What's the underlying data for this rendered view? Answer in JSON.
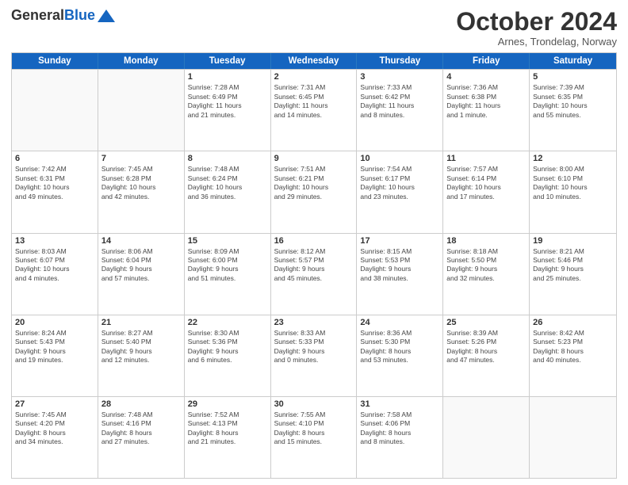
{
  "header": {
    "logo_general": "General",
    "logo_blue": "Blue",
    "month": "October 2024",
    "location": "Arnes, Trondelag, Norway"
  },
  "days_of_week": [
    "Sunday",
    "Monday",
    "Tuesday",
    "Wednesday",
    "Thursday",
    "Friday",
    "Saturday"
  ],
  "weeks": [
    [
      {
        "date": "",
        "info": ""
      },
      {
        "date": "",
        "info": ""
      },
      {
        "date": "1",
        "info": "Sunrise: 7:28 AM\nSunset: 6:49 PM\nDaylight: 11 hours\nand 21 minutes."
      },
      {
        "date": "2",
        "info": "Sunrise: 7:31 AM\nSunset: 6:45 PM\nDaylight: 11 hours\nand 14 minutes."
      },
      {
        "date": "3",
        "info": "Sunrise: 7:33 AM\nSunset: 6:42 PM\nDaylight: 11 hours\nand 8 minutes."
      },
      {
        "date": "4",
        "info": "Sunrise: 7:36 AM\nSunset: 6:38 PM\nDaylight: 11 hours\nand 1 minute."
      },
      {
        "date": "5",
        "info": "Sunrise: 7:39 AM\nSunset: 6:35 PM\nDaylight: 10 hours\nand 55 minutes."
      }
    ],
    [
      {
        "date": "6",
        "info": "Sunrise: 7:42 AM\nSunset: 6:31 PM\nDaylight: 10 hours\nand 49 minutes."
      },
      {
        "date": "7",
        "info": "Sunrise: 7:45 AM\nSunset: 6:28 PM\nDaylight: 10 hours\nand 42 minutes."
      },
      {
        "date": "8",
        "info": "Sunrise: 7:48 AM\nSunset: 6:24 PM\nDaylight: 10 hours\nand 36 minutes."
      },
      {
        "date": "9",
        "info": "Sunrise: 7:51 AM\nSunset: 6:21 PM\nDaylight: 10 hours\nand 29 minutes."
      },
      {
        "date": "10",
        "info": "Sunrise: 7:54 AM\nSunset: 6:17 PM\nDaylight: 10 hours\nand 23 minutes."
      },
      {
        "date": "11",
        "info": "Sunrise: 7:57 AM\nSunset: 6:14 PM\nDaylight: 10 hours\nand 17 minutes."
      },
      {
        "date": "12",
        "info": "Sunrise: 8:00 AM\nSunset: 6:10 PM\nDaylight: 10 hours\nand 10 minutes."
      }
    ],
    [
      {
        "date": "13",
        "info": "Sunrise: 8:03 AM\nSunset: 6:07 PM\nDaylight: 10 hours\nand 4 minutes."
      },
      {
        "date": "14",
        "info": "Sunrise: 8:06 AM\nSunset: 6:04 PM\nDaylight: 9 hours\nand 57 minutes."
      },
      {
        "date": "15",
        "info": "Sunrise: 8:09 AM\nSunset: 6:00 PM\nDaylight: 9 hours\nand 51 minutes."
      },
      {
        "date": "16",
        "info": "Sunrise: 8:12 AM\nSunset: 5:57 PM\nDaylight: 9 hours\nand 45 minutes."
      },
      {
        "date": "17",
        "info": "Sunrise: 8:15 AM\nSunset: 5:53 PM\nDaylight: 9 hours\nand 38 minutes."
      },
      {
        "date": "18",
        "info": "Sunrise: 8:18 AM\nSunset: 5:50 PM\nDaylight: 9 hours\nand 32 minutes."
      },
      {
        "date": "19",
        "info": "Sunrise: 8:21 AM\nSunset: 5:46 PM\nDaylight: 9 hours\nand 25 minutes."
      }
    ],
    [
      {
        "date": "20",
        "info": "Sunrise: 8:24 AM\nSunset: 5:43 PM\nDaylight: 9 hours\nand 19 minutes."
      },
      {
        "date": "21",
        "info": "Sunrise: 8:27 AM\nSunset: 5:40 PM\nDaylight: 9 hours\nand 12 minutes."
      },
      {
        "date": "22",
        "info": "Sunrise: 8:30 AM\nSunset: 5:36 PM\nDaylight: 9 hours\nand 6 minutes."
      },
      {
        "date": "23",
        "info": "Sunrise: 8:33 AM\nSunset: 5:33 PM\nDaylight: 9 hours\nand 0 minutes."
      },
      {
        "date": "24",
        "info": "Sunrise: 8:36 AM\nSunset: 5:30 PM\nDaylight: 8 hours\nand 53 minutes."
      },
      {
        "date": "25",
        "info": "Sunrise: 8:39 AM\nSunset: 5:26 PM\nDaylight: 8 hours\nand 47 minutes."
      },
      {
        "date": "26",
        "info": "Sunrise: 8:42 AM\nSunset: 5:23 PM\nDaylight: 8 hours\nand 40 minutes."
      }
    ],
    [
      {
        "date": "27",
        "info": "Sunrise: 7:45 AM\nSunset: 4:20 PM\nDaylight: 8 hours\nand 34 minutes."
      },
      {
        "date": "28",
        "info": "Sunrise: 7:48 AM\nSunset: 4:16 PM\nDaylight: 8 hours\nand 27 minutes."
      },
      {
        "date": "29",
        "info": "Sunrise: 7:52 AM\nSunset: 4:13 PM\nDaylight: 8 hours\nand 21 minutes."
      },
      {
        "date": "30",
        "info": "Sunrise: 7:55 AM\nSunset: 4:10 PM\nDaylight: 8 hours\nand 15 minutes."
      },
      {
        "date": "31",
        "info": "Sunrise: 7:58 AM\nSunset: 4:06 PM\nDaylight: 8 hours\nand 8 minutes."
      },
      {
        "date": "",
        "info": ""
      },
      {
        "date": "",
        "info": ""
      }
    ]
  ]
}
